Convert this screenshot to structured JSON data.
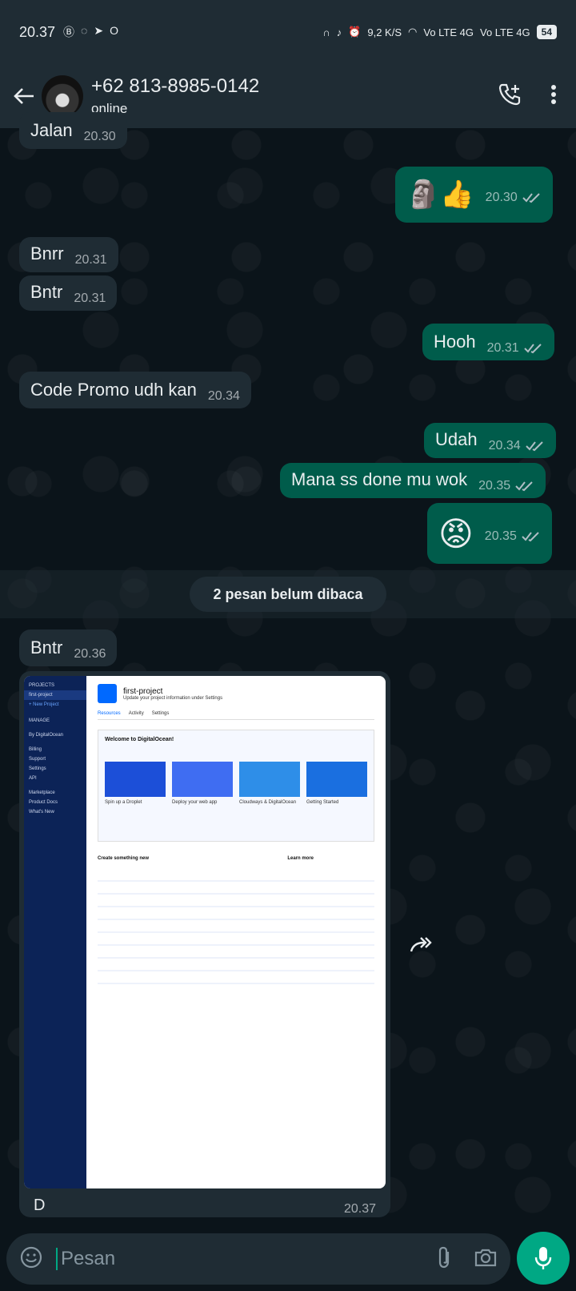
{
  "status": {
    "time": "20.37",
    "speed": "9,2 K/S",
    "net1": "Vo LTE 4G",
    "net2": "Vo LTE 4G",
    "battery": "54"
  },
  "header": {
    "contact_name": "+62 813-8985-0142",
    "contact_status": "online"
  },
  "messages": [
    {
      "text": "Jalan",
      "time": "20.30",
      "dir": "in"
    },
    {
      "text": "🗿👍",
      "time": "20.30",
      "dir": "out"
    },
    {
      "text": "Bnrr",
      "time": "20.31",
      "dir": "in"
    },
    {
      "text": "Bntr",
      "time": "20.31",
      "dir": "in"
    },
    {
      "text": "Hooh",
      "time": "20.31",
      "dir": "out"
    },
    {
      "text": "Code Promo udh kan",
      "time": "20.34",
      "dir": "in"
    },
    {
      "text": "Udah",
      "time": "20.34",
      "dir": "out"
    },
    {
      "text": "Mana ss done mu wok",
      "time": "20.35",
      "dir": "out"
    },
    {
      "text": "😡",
      "time": "20.35",
      "dir": "out"
    },
    {
      "text": "Bntr",
      "time": "20.36",
      "dir": "in"
    }
  ],
  "unread_label": "2 pesan belum dibaca",
  "image_message": {
    "caption": "D",
    "time": "20.37",
    "screenshot": {
      "sidebar": [
        "PROJECTS",
        "first-project",
        "+ New Project",
        "MANAGE",
        "By DigitalOcean",
        "Billing",
        "Support",
        "Settings",
        "API",
        "Marketplace",
        "Product Docs",
        "What's New"
      ],
      "title": "first-project",
      "subtitle": "Update your project information under Settings",
      "tabs": [
        "Resources",
        "Activity",
        "Settings"
      ],
      "welcome": "Welcome to DigitalOcean!",
      "cards": [
        "Spin up a Droplet",
        "Deploy your web app",
        "Cloudways & DigitalOcean",
        "Getting Started"
      ],
      "create_heading": "Create something new",
      "learn_heading": "Learn more"
    }
  },
  "input": {
    "placeholder": "Pesan"
  }
}
